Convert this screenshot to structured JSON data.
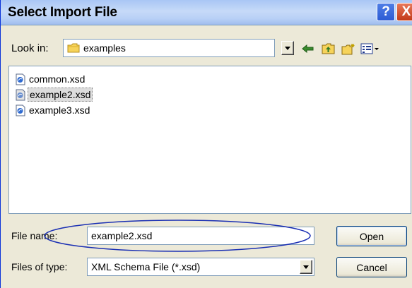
{
  "dialog": {
    "title": "Select Import File",
    "help_symbol": "?",
    "close_symbol": "X"
  },
  "look_in": {
    "label": "Look in:",
    "value": "examples"
  },
  "toolbar": {
    "icons": [
      "back-arrow-icon",
      "up-folder-icon",
      "new-folder-icon",
      "views-menu-icon"
    ]
  },
  "files": [
    {
      "name": "common.xsd",
      "selected": false
    },
    {
      "name": "example2.xsd",
      "selected": true
    },
    {
      "name": "example3.xsd",
      "selected": false
    }
  ],
  "file_name": {
    "label": "File name:",
    "value": "example2.xsd"
  },
  "file_type": {
    "label": "Files of type:",
    "value": "XML Schema File (*.xsd)"
  },
  "buttons": {
    "open": "Open",
    "cancel": "Cancel"
  },
  "colors": {
    "highlight_ellipse": "#1a2fb3",
    "title_bar": "#b8d0f6",
    "dialog_face": "#ece9d8"
  }
}
